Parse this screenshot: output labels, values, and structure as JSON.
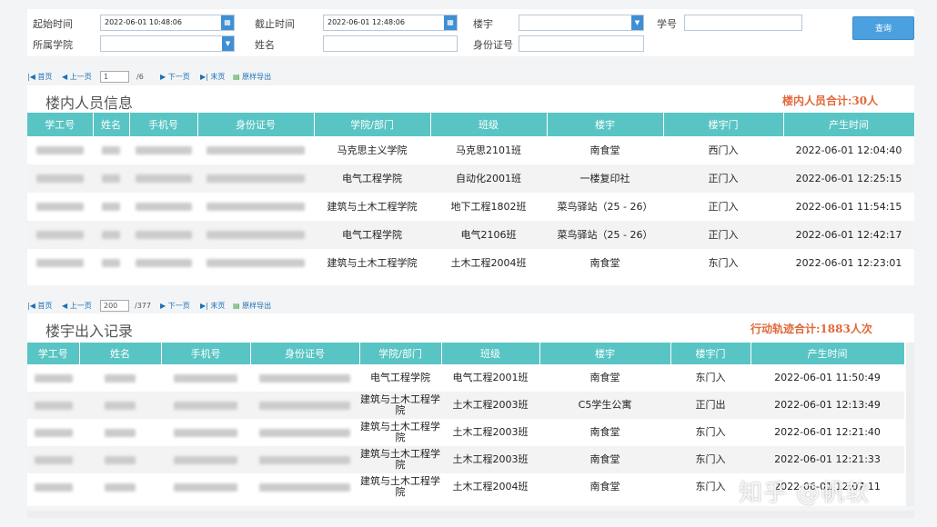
{
  "filters": {
    "start_label": "起始时间",
    "start_value": "2022-06-01 10:48:06",
    "end_label": "截止时间",
    "end_value": "2022-06-01 12:48:06",
    "building_label": "楼宇",
    "building_value": "",
    "student_no_label": "学号",
    "student_no_value": "",
    "college_label": "所属学院",
    "college_value": "",
    "name_label": "姓名",
    "name_value": "",
    "id_label": "身份证号",
    "id_value": "",
    "query_button": "查询",
    "calendar_icon": "calendar-icon",
    "dropdown_icon": "chevron-down-icon"
  },
  "pager1": {
    "first": "首页",
    "prev": "上一页",
    "page": "1",
    "total": "/6",
    "next": "下一页",
    "last": "末页",
    "export": "原样导出"
  },
  "pager2": {
    "first": "首页",
    "prev": "上一页",
    "page": "200",
    "total": "/377",
    "next": "下一页",
    "last": "末页",
    "export": "原样导出"
  },
  "inside": {
    "title": "楼内人员信息",
    "total": "楼内人员合计:30人",
    "headers": [
      "学工号",
      "姓名",
      "手机号",
      "身份证号",
      "学院/部门",
      "班级",
      "楼宇",
      "楼宇门",
      "产生时间"
    ],
    "rows": [
      {
        "college": "马克思主义学院",
        "class": "马克思2101班",
        "building": "南食堂",
        "gate": "西门入",
        "time": "2022-06-01 12:04:40"
      },
      {
        "college": "电气工程学院",
        "class": "自动化2001班",
        "building": "一楼复印社",
        "gate": "正门入",
        "time": "2022-06-01 12:25:15"
      },
      {
        "college": "建筑与土木工程学院",
        "class": "地下工程1802班",
        "building": "菜鸟驿站（25 - 26）",
        "gate": "正门入",
        "time": "2022-06-01 11:54:15"
      },
      {
        "college": "电气工程学院",
        "class": "电气2106班",
        "building": "菜鸟驿站（25 - 26）",
        "gate": "正门入",
        "time": "2022-06-01 12:42:17"
      },
      {
        "college": "建筑与土木工程学院",
        "class": "土木工程2004班",
        "building": "南食堂",
        "gate": "东门入",
        "time": "2022-06-01 12:23:01"
      }
    ]
  },
  "records": {
    "title": "楼宇出入记录",
    "total": "行动轨迹合计:1883人次",
    "headers": [
      "学工号",
      "姓名",
      "手机号",
      "身份证号",
      "学院/部门",
      "班级",
      "楼宇",
      "楼宇门",
      "产生时间"
    ],
    "rows": [
      {
        "college": "电气工程学院",
        "class": "电气工程2001班",
        "building": "南食堂",
        "gate": "东门入",
        "time": "2022-06-01 11:50:49"
      },
      {
        "college": "建筑与土木工程学院",
        "class": "土木工程2003班",
        "building": "C5学生公寓",
        "gate": "正门出",
        "time": "2022-06-01 12:13:49"
      },
      {
        "college": "建筑与土木工程学院",
        "class": "土木工程2003班",
        "building": "南食堂",
        "gate": "东门入",
        "time": "2022-06-01 12:21:40"
      },
      {
        "college": "建筑与土木工程学院",
        "class": "土木工程2003班",
        "building": "南食堂",
        "gate": "东门入",
        "time": "2022-06-01 12:21:33"
      },
      {
        "college": "建筑与土木工程学院",
        "class": "土木工程2004班",
        "building": "南食堂",
        "gate": "东门入",
        "time": "2022-06-01 12:07:11"
      }
    ]
  },
  "watermark": "知乎 @帆软",
  "colors": {
    "header_bg": "#59c4c4",
    "total_text": "#e0683a",
    "button_bg": "#4ba0e0"
  }
}
